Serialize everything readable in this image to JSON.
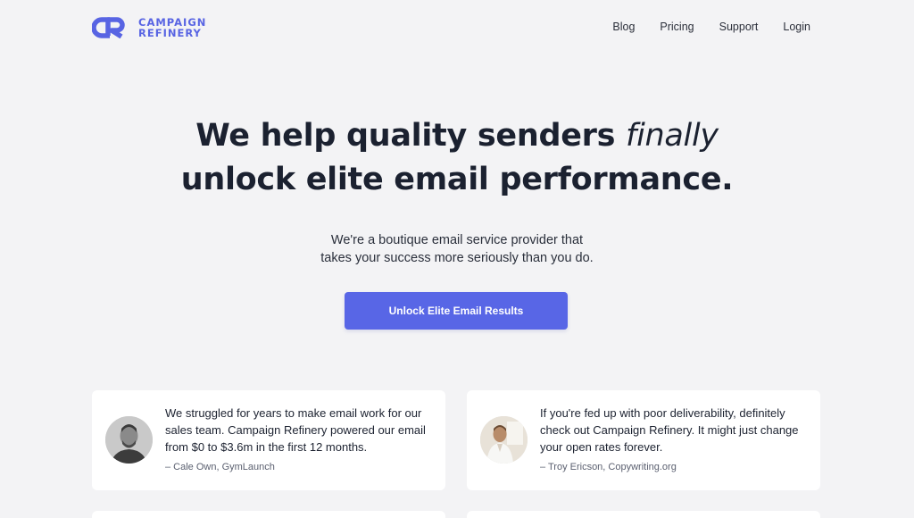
{
  "brand": {
    "name_line1": "CAMPAIGN",
    "name_line2": "REFINERY",
    "logo_icon": "cr-monogram-icon",
    "color": "#5864e3"
  },
  "nav": {
    "items": [
      {
        "label": "Blog"
      },
      {
        "label": "Pricing"
      },
      {
        "label": "Support"
      },
      {
        "label": "Login"
      }
    ]
  },
  "hero": {
    "title_line1_a": "We help quality senders",
    "title_line1_em": "finally",
    "title_line2": "unlock elite email performance.",
    "subtitle_line1": "We're a boutique email service provider that",
    "subtitle_line2": "takes your success more seriously than you do.",
    "cta_label": "Unlock Elite Email Results",
    "cta_color": "#5866e6"
  },
  "testimonials": [
    {
      "quote": "We struggled for years to make email work for our sales team. Campaign Refinery powered our email from $0 to $3.6m in the first 12 months.",
      "author": "– Cale Own, GymLaunch"
    },
    {
      "quote": "If you're fed up with poor deliverability, definitely check out Campaign Refinery. It might just change your open rates forever.",
      "author": "– Troy Ericson, Copywriting.org"
    }
  ]
}
